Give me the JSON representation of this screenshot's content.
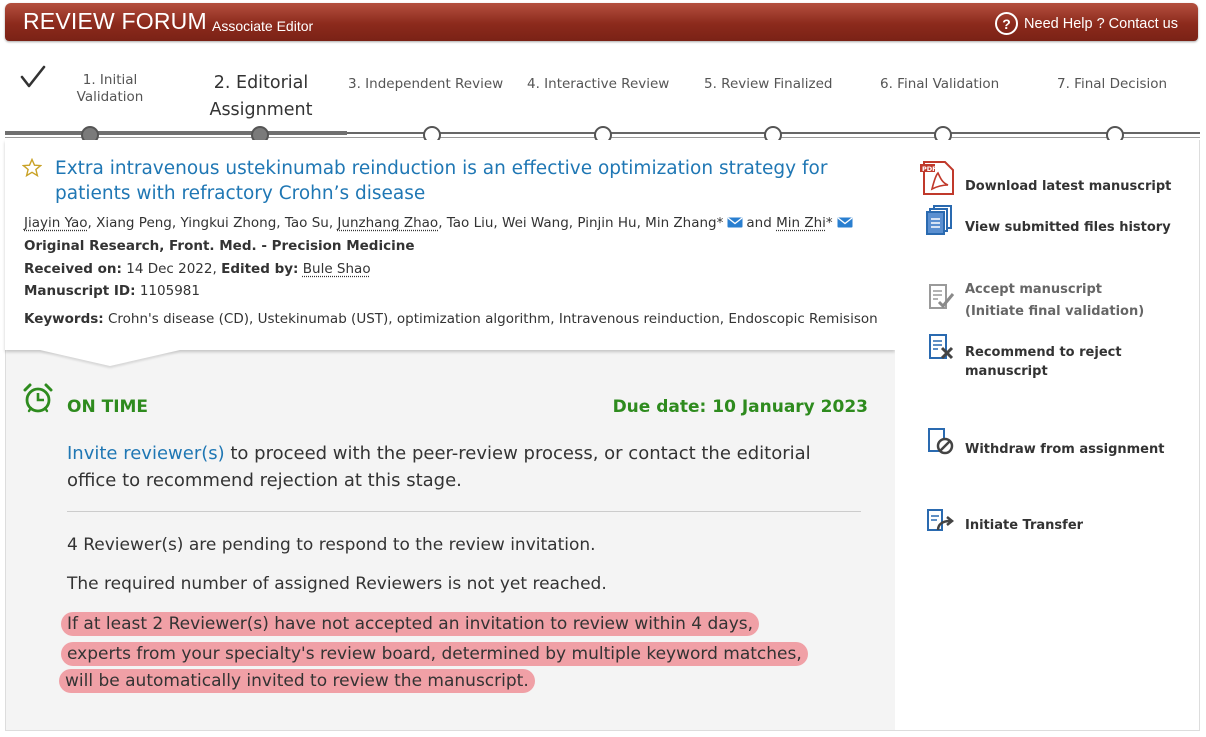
{
  "header": {
    "brand": "REVIEW FORUM",
    "role": "Associate Editor",
    "help": "Need Help ? Contact us",
    "help_icon": "question-circle-icon"
  },
  "steps": [
    {
      "label": "1. Initial",
      "label2": "Validation",
      "state": "done"
    },
    {
      "label": "2. Editorial",
      "label2": "Assignment",
      "state": "current"
    },
    {
      "label": "3. Independent Review",
      "state": "pending"
    },
    {
      "label": "4. Interactive Review",
      "state": "pending"
    },
    {
      "label": "5. Review Finalized",
      "state": "pending"
    },
    {
      "label": "6. Final Validation",
      "state": "pending"
    },
    {
      "label": "7. Final Decision",
      "state": "pending"
    }
  ],
  "article": {
    "title_line1": "Extra intravenous ustekinumab reinduction is an effective optimization strategy for",
    "title_line2": "patients with refractory Crohn’s disease",
    "authors": {
      "a1": "Jiayin Yao",
      "a2": ", Xiang Peng, Yingkui Zhong, Tao Su, ",
      "a3": "Junzhang Zhao",
      "a4": ", Tao Liu, Wei Wang, Pinjin Hu, Min Zhang*",
      "and": "and",
      "a5": "Min Zhi",
      "a5_suffix": "*"
    },
    "type_line": "Original Research, Front. Med. - Precision Medicine",
    "received_label": "Received on:",
    "received_value": "14 Dec 2022,",
    "edited_label": "Edited by:",
    "edited_value": "Bule Shao",
    "msid_label": "Manuscript ID:",
    "msid_value": "1105981",
    "keywords_label": "Keywords:",
    "keywords_value": "Crohn's disease (CD), Ustekinumab (UST), optimization algorithm, Intravenous reinduction, Endoscopic Remisison"
  },
  "status": {
    "label": "ON TIME",
    "due": "Due date: 10 January 2023",
    "invite_link": "Invite reviewer(s)",
    "invite_rest_1": " to proceed with the peer-review process, or contact the editorial",
    "invite_rest_2": "office to recommend rejection at this stage.",
    "pending": "4 Reviewer(s) are pending to respond to the review invitation.",
    "required": "The required number of assigned Reviewers is not yet reached.",
    "auto_1": "If at least 2 Reviewer(s) have not accepted an invitation to review within 4 days,",
    "auto_2": "experts from your specialty's review board, determined by multiple keyword matches,",
    "auto_3": "will be automatically invited to review the manuscript."
  },
  "actions": {
    "download": "Download latest manuscript",
    "history": "View submitted files history",
    "accept_1": "Accept manuscript",
    "accept_2": "(Initiate final validation)",
    "reject_1": "Recommend to reject",
    "reject_2": "manuscript",
    "withdraw": "Withdraw from assignment",
    "transfer": "Initiate Transfer"
  },
  "colors": {
    "header": "#8c2a1c",
    "link": "#1f77b4",
    "ontime": "#2e8b1e",
    "highlight": "#f0a0a6"
  }
}
